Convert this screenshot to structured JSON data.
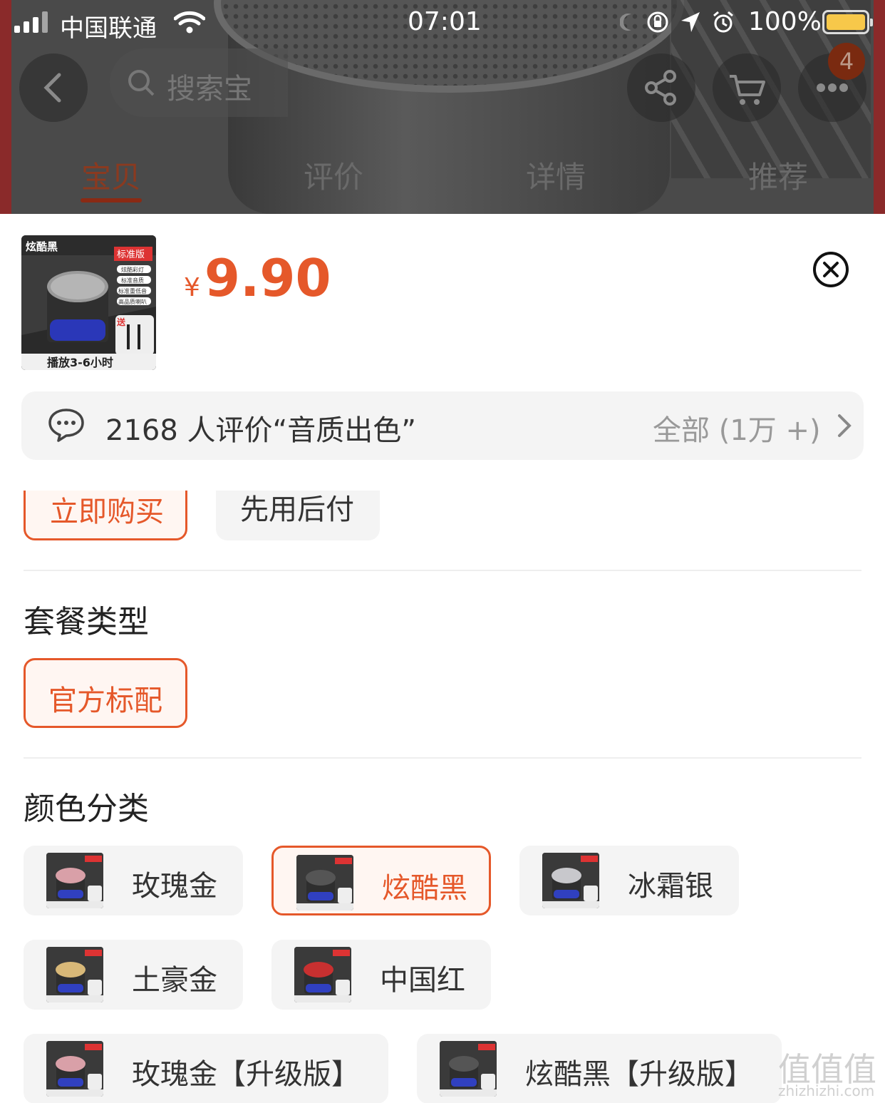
{
  "status_bar": {
    "carrier": "中国联通",
    "time": "07:01",
    "battery": "100%"
  },
  "nav": {
    "search_placeholder": "搜索宝",
    "cart_badge": "4"
  },
  "tabs": [
    {
      "label": "宝贝",
      "active": true
    },
    {
      "label": "评价",
      "active": false
    },
    {
      "label": "详情",
      "active": false
    },
    {
      "label": "推荐",
      "active": false
    }
  ],
  "product": {
    "currency": "¥",
    "price": "9.90",
    "thumb": {
      "brand": "炫酷黑",
      "badge": "标准版",
      "features": [
        "炫酷彩灯",
        "标准音质",
        "标准重低音",
        "高品质喇叭"
      ],
      "gift": "送",
      "caption": "播放3-6小时"
    }
  },
  "review": {
    "summary": "2168 人评价“音质出色”",
    "all": "全部 (1万 +)"
  },
  "purchase_options": {
    "buy_now": "立即购买",
    "pay_later": "先用后付"
  },
  "package": {
    "title": "套餐类型",
    "options": [
      {
        "label": "官方标配",
        "selected": true
      }
    ]
  },
  "color": {
    "title": "颜色分类",
    "options": [
      {
        "label": "玫瑰金",
        "selected": false,
        "swatch": "#d9a0a8"
      },
      {
        "label": "炫酷黑",
        "selected": true,
        "swatch": "#555555"
      },
      {
        "label": "冰霜银",
        "selected": false,
        "swatch": "#c8c8cc"
      },
      {
        "label": "土豪金",
        "selected": false,
        "swatch": "#d8b878"
      },
      {
        "label": "中国红",
        "selected": false,
        "swatch": "#c83030"
      },
      {
        "label": "玫瑰金【升级版】",
        "selected": false,
        "swatch": "#d9a0a8"
      },
      {
        "label": "炫酷黑【升级版】",
        "selected": false,
        "swatch": "#555555"
      }
    ]
  },
  "watermark": {
    "big": "值值值",
    "small": "zhizhizhi.com"
  },
  "colors": {
    "accent": "#e5582a",
    "chip_bg": "#f4f4f4",
    "chip_selected_bg": "#fff6f2"
  }
}
